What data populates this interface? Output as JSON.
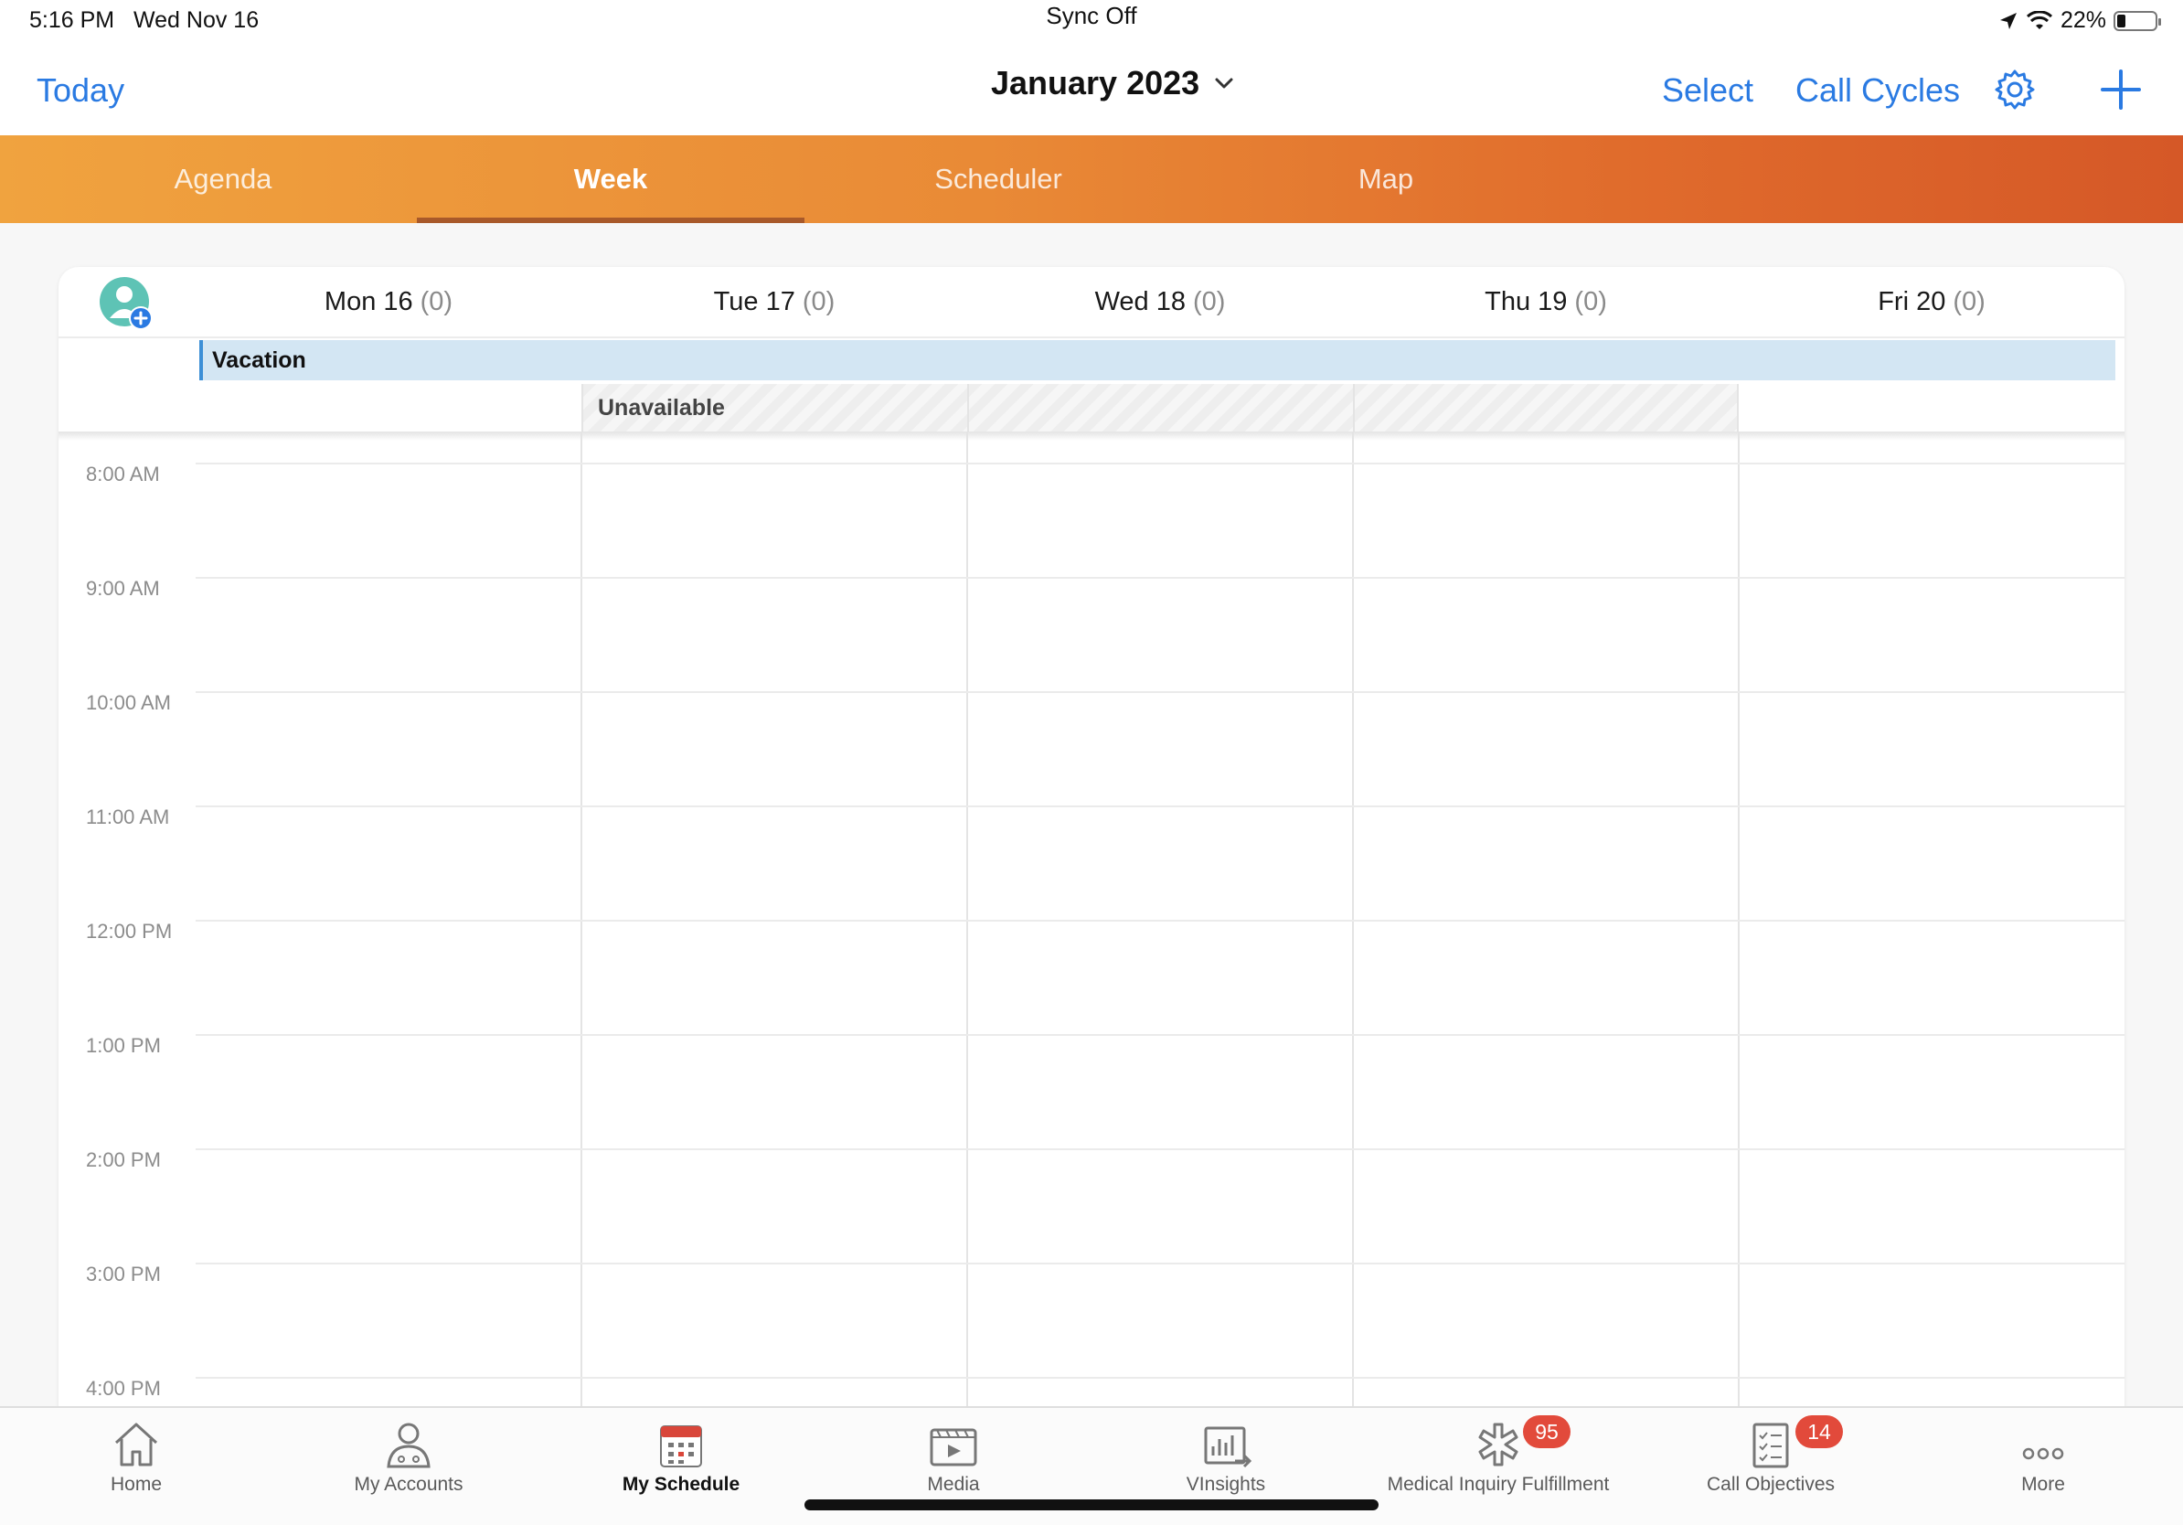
{
  "status_bar": {
    "time": "5:16 PM",
    "date": "Wed Nov 16",
    "sync": "Sync Off",
    "battery": "22%",
    "battery_level": 0.22
  },
  "nav": {
    "today": "Today",
    "title": "January 2023",
    "select": "Select",
    "call_cycles": "Call Cycles"
  },
  "view_tabs": [
    {
      "label": "Agenda",
      "active": false
    },
    {
      "label": "Week",
      "active": true
    },
    {
      "label": "Scheduler",
      "active": false
    },
    {
      "label": "Map",
      "active": false
    }
  ],
  "calendar": {
    "days": [
      {
        "label": "Mon 16",
        "count": "(0)"
      },
      {
        "label": "Tue 17",
        "count": "(0)"
      },
      {
        "label": "Wed 18",
        "count": "(0)"
      },
      {
        "label": "Thu 19",
        "count": "(0)"
      },
      {
        "label": "Fri 20",
        "count": "(0)"
      }
    ],
    "all_day_event": "Vacation",
    "unavailable": "Unavailable",
    "times": [
      "8:00 AM",
      "9:00 AM",
      "10:00 AM",
      "11:00 AM",
      "12:00 PM",
      "1:00 PM",
      "2:00 PM",
      "3:00 PM",
      "4:00 PM"
    ]
  },
  "bottom_tabs": [
    {
      "label": "Home",
      "icon": "home-icon",
      "badge": "",
      "active": false
    },
    {
      "label": "My Accounts",
      "icon": "person-icon",
      "badge": "",
      "active": false
    },
    {
      "label": "My Schedule",
      "icon": "calendar-icon",
      "badge": "",
      "active": true
    },
    {
      "label": "Media",
      "icon": "media-icon",
      "badge": "",
      "active": false
    },
    {
      "label": "VInsights",
      "icon": "insights-icon",
      "badge": "",
      "active": false
    },
    {
      "label": "Medical Inquiry Fulfillment",
      "icon": "medical-icon",
      "badge": "95",
      "active": false
    },
    {
      "label": "Call Objectives",
      "icon": "checklist-icon",
      "badge": "14",
      "active": false
    },
    {
      "label": "More",
      "icon": "more-icon",
      "badge": "",
      "active": false
    }
  ],
  "colors": {
    "accent": "#2a7ae2",
    "tab_gradient_start": "#f0a33f",
    "tab_gradient_end": "#d55827",
    "vacation_bg": "#d3e6f3",
    "badge": "#e24a3b"
  }
}
